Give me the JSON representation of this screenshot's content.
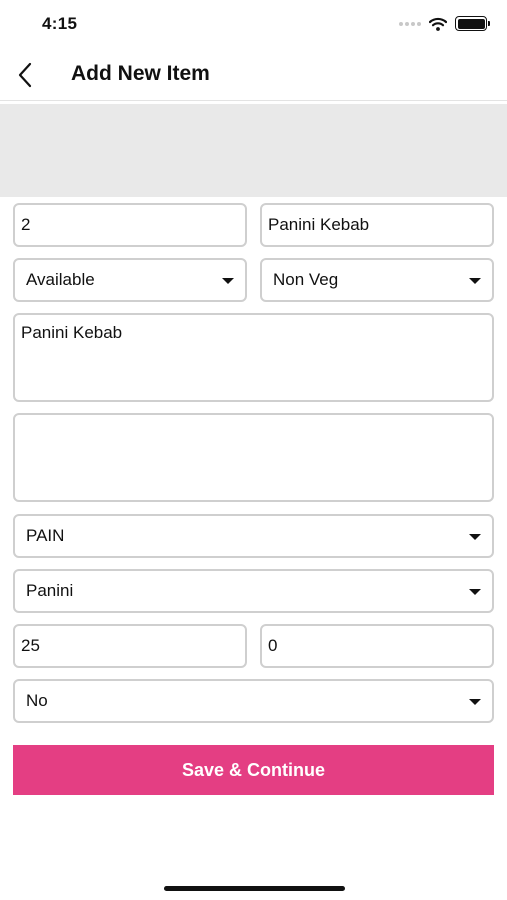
{
  "status_bar": {
    "time": "4:15"
  },
  "header": {
    "title": "Add New Item"
  },
  "form": {
    "number_value": "2",
    "name_value": "Panini Kebab",
    "availability_selected": "Available",
    "diet_type_selected": "Non Veg",
    "description_value": "Panini Kebab",
    "notes_value": "",
    "category_selected": "PAIN",
    "subcategory_selected": "Panini",
    "price_value": "25",
    "discount_value": "0",
    "option_selected": "No"
  },
  "actions": {
    "save_label": "Save & Continue"
  },
  "colors": {
    "accent": "#e43e83",
    "field_border": "#cfcfcf",
    "image_placeholder": "#e9e9e9"
  },
  "icons": [
    "back-arrow-icon",
    "wifi-icon",
    "battery-icon",
    "signal-icon",
    "caret-down-icon"
  ]
}
